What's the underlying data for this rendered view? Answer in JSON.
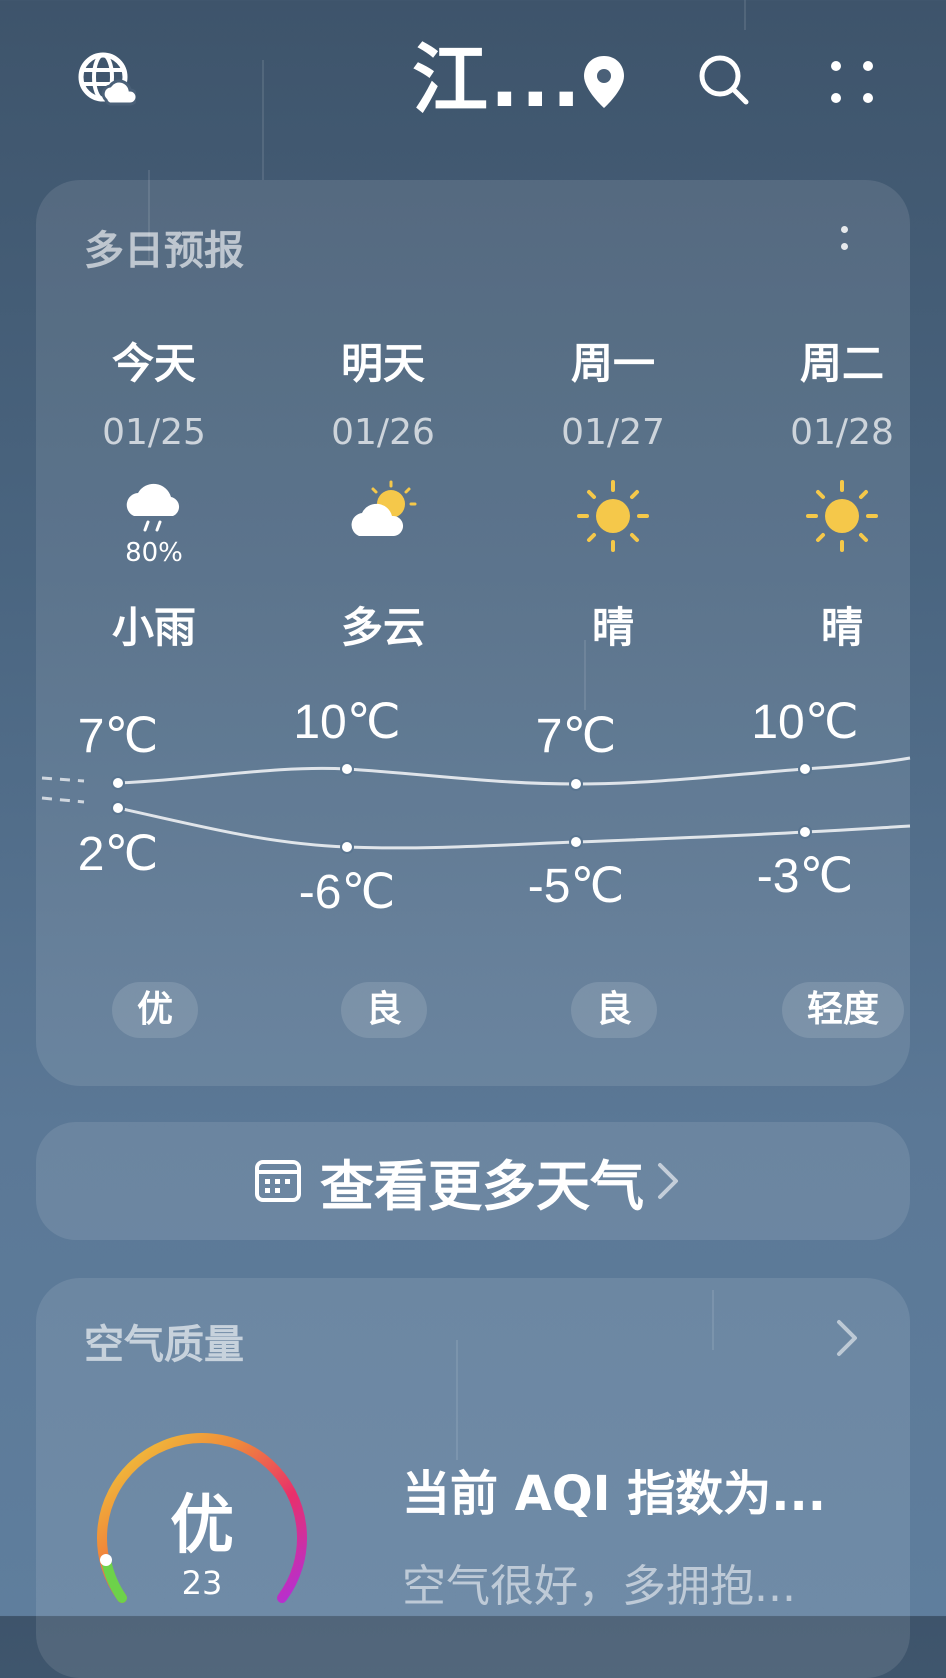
{
  "header": {
    "city": "江...",
    "icons": [
      "globe-weather-icon",
      "location-pin-icon",
      "search-icon",
      "more-dots-icon"
    ]
  },
  "forecast": {
    "title": "多日预报",
    "days": [
      {
        "day": "今天",
        "date": "01/25",
        "icon": "light-rain-icon",
        "precip": "80%",
        "cond": "小雨",
        "high": "7℃",
        "low": "2℃",
        "aqi": "优"
      },
      {
        "day": "明天",
        "date": "01/26",
        "icon": "partly-cloudy-icon",
        "precip": "",
        "cond": "多云",
        "high": "10℃",
        "low": "-6℃",
        "aqi": "良"
      },
      {
        "day": "周一",
        "date": "01/27",
        "icon": "sunny-icon",
        "precip": "",
        "cond": "晴",
        "high": "7℃",
        "low": "-5℃",
        "aqi": "良"
      },
      {
        "day": "周二",
        "date": "01/28",
        "icon": "sunny-icon",
        "precip": "",
        "cond": "晴",
        "high": "10℃",
        "low": "-3℃",
        "aqi": "轻度"
      }
    ]
  },
  "more_weather": {
    "label": "查看更多天气"
  },
  "air_quality": {
    "title": "空气质量",
    "level": "优",
    "aqi_value": "23",
    "headline": "当前 AQI 指数为...",
    "advice": "空气很好，多拥抱..."
  },
  "colors": {
    "sun": "#f5c84a",
    "gauge_gradient": [
      "#f0d13a",
      "#f08a3a",
      "#e8306a",
      "#b22fd9",
      "#6dd24a"
    ]
  }
}
